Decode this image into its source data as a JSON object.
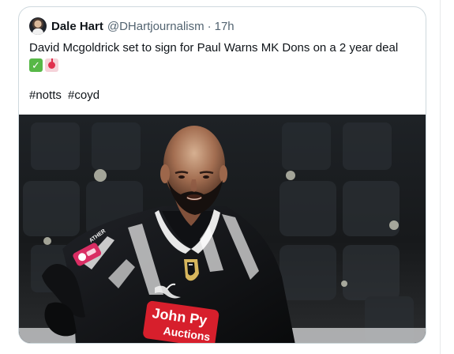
{
  "tweet": {
    "author": {
      "name": "Dale Hart",
      "handle": "@DHartjournalism",
      "separator": "·",
      "time": "17h"
    },
    "text": "David Mcgoldrick set to sign for Paul Warns MK Dons on a 2 year deal",
    "emojis": [
      {
        "icon": "check-mark-emoji",
        "glyph": "✓"
      },
      {
        "icon": "siren-emoji"
      }
    ],
    "hashtags": [
      "#notts",
      "#coyd"
    ]
  },
  "media": {
    "sponsor_text_line1": "John Py",
    "sponsor_text_line2": "Auctions",
    "shirt_logo_text": "ATHER"
  },
  "colors": {
    "text": "#0f1419",
    "muted": "#536471",
    "card_border": "#cfd9de",
    "check": "#57b847",
    "siren": "#e0304d",
    "sponsor_red": "#d71f2c"
  }
}
